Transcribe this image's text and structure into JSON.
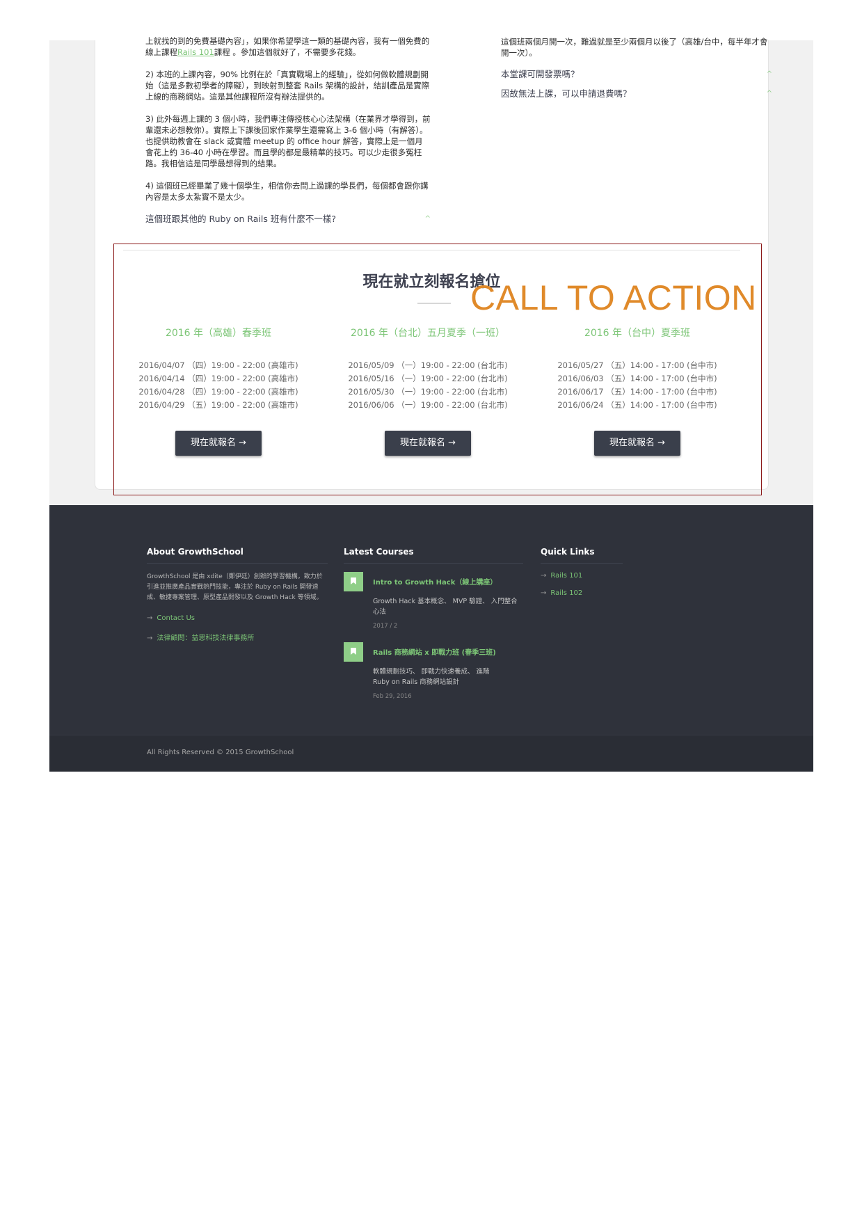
{
  "faq_left": {
    "p0": "上就找的到的免費基礎內容」，如果你希望學這一類的基礎內容，我有一個免費的線上課程",
    "p0_link": "Rails 101",
    "p0_tail": "課程 。參加這個就好了，不需要多花錢。",
    "p1": "2) 本班的上課內容，90% 比例在於「真實戰場上的經驗」，從如何做軟體規劃開始（這是多數初學者的障礙），到映射到整套 Rails 架構的設計，結訓產品是實際上線的商務網站。這是其他課程所沒有辦法提供的。",
    "p2": "3) 此外每週上課的 3 個小時，我們專注傳授核心心法架構（在業界才學得到，前輩還未必想教你）。實際上下課後回家作業學生還需寫上 3-6 個小時（有解答）。也提供助教會在 slack 或實體 meetup 的 office hour 解答，實際上是一個月會花上約 36-40 小時在學習。而且學的都是最精華的技巧。可以少走很多冤枉路。我相信這是同學最想得到的結果。",
    "p3": "4) 這個班已經畢業了幾十個學生，相信你去問上過課的學長們，每個都會跟你講內容是太多太紮實不是太少。",
    "question": "這個班跟其他的 Ruby on Rails 班有什麼不一樣?"
  },
  "faq_right": {
    "p0": "這個班兩個月開一次，難過就是至少兩個月以後了（高雄/台中，每半年才會開一次）。",
    "q1": "本堂課可開發票嗎？",
    "q2": "因故無法上課，可以申請退費嗎？"
  },
  "chevron": "^",
  "cta": {
    "title": "現在就立刻報名搶位",
    "columns": [
      {
        "title": "2016 年（高雄）春季班",
        "dates": [
          "2016/04/07 （四）19:00 - 22:00 (高雄市)",
          "2016/04/14 （四）19:00 - 22:00 (高雄市)",
          "2016/04/28 （四）19:00 - 22:00 (高雄市)",
          "2016/04/29 （五）19:00 - 22:00 (高雄市)"
        ],
        "button": "現在就報名 →"
      },
      {
        "title": "2016 年（台北）五月夏季（一班）",
        "dates": [
          "2016/05/09 （一）19:00 - 22:00 (台北市)",
          "2016/05/16 （一）19:00 - 22:00 (台北市)",
          "2016/05/30 （一）19:00 - 22:00 (台北市)",
          "2016/06/06 （一）19:00 - 22:00 (台北市)"
        ],
        "button": "現在就報名 →"
      },
      {
        "title": "2016 年（台中）夏季班",
        "dates": [
          "2016/05/27 （五）14:00 - 17:00 (台中市)",
          "2016/06/03 （五）14:00 - 17:00 (台中市)",
          "2016/06/17 （五）14:00 - 17:00 (台中市)",
          "2016/06/24 （五）14:00 - 17:00 (台中市)"
        ],
        "button": "現在就報名 →"
      }
    ]
  },
  "footer": {
    "about": {
      "heading": "About GrowthSchool",
      "text": "GrowthSchool 是由 xdite（鄭伊廷）創辦的學習機構，致力於引進並推廣產品實戰熱門技能，專注於 Ruby on Rails 開發速成、敏捷專案管理、原型產品開發以及 Growth Hack 等領域。",
      "links": [
        "Contact Us",
        "法律顧問：益思科技法律事務所"
      ]
    },
    "courses": {
      "heading": "Latest Courses",
      "items": [
        {
          "title": "Intro to Growth Hack（線上講座）",
          "desc": "Growth Hack 基本概念、 MVP 驗證、 入門整合心法",
          "date": "2017 / 2"
        },
        {
          "title": "Rails 商務網站 x 即戰力班 (春季三班)",
          "desc": "軟體規劃技巧、 即戰力快速養成、 進階 Ruby on Rails 商務網站設計",
          "date": "Feb 29, 2016"
        }
      ]
    },
    "quick": {
      "heading": "Quick Links",
      "links": [
        "Rails 101",
        "Rails 102"
      ]
    },
    "arrow": "→",
    "copyright": "All Rights Reserved © 2015 GrowthSchool"
  },
  "annotation": {
    "label": "CALL TO ACTION",
    "box_color": "#8b1a1a",
    "label_color": "#e08a2a"
  }
}
